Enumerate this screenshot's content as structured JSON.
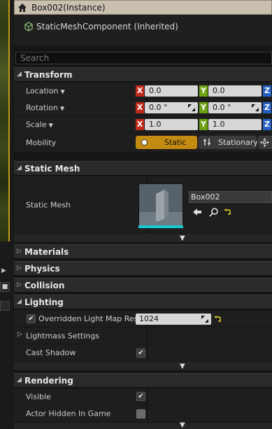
{
  "title_bar": {
    "title": "Box002(Instance)"
  },
  "component": {
    "label": "StaticMeshComponent (Inherited)"
  },
  "search": {
    "placeholder": "Search"
  },
  "transform": {
    "header": "Transform",
    "location": {
      "label": "Location",
      "x": "0.0",
      "y": "0.0",
      "z": "Z"
    },
    "rotation": {
      "label": "Rotation",
      "x": "0.0 °",
      "y": "0.0 °",
      "z": "Z"
    },
    "scale": {
      "label": "Scale",
      "x": "1.0",
      "y": "1.0",
      "z": "Z"
    },
    "axis_labels": {
      "x": "X",
      "y": "Y"
    },
    "mobility": {
      "label": "Mobility",
      "static": "Static",
      "stationary": "Stationary",
      "selected": "Static"
    }
  },
  "static_mesh": {
    "header": "Static Mesh",
    "label": "Static Mesh",
    "asset_name": "Box002"
  },
  "sections": {
    "materials": "Materials",
    "physics": "Physics",
    "collision": "Collision",
    "lighting": "Lighting",
    "rendering": "Rendering"
  },
  "lighting": {
    "override_label": "Overridden Light Map Res",
    "override_checked": true,
    "light_map_res": "1024",
    "lightmass_label": "Lightmass Settings",
    "cast_shadow_label": "Cast Shadow",
    "cast_shadow_checked": true
  },
  "rendering": {
    "visible_label": "Visible",
    "visible_checked": true,
    "hidden_label": "Actor Hidden In Game",
    "hidden_checked": false
  },
  "colors": {
    "accent_static": "#c48b12",
    "axis_x": "#c02a1b",
    "axis_y": "#6ea314",
    "axis_z": "#2760c4",
    "thumb_bar": "#16c7d4"
  },
  "glyphs": {
    "check": "✔",
    "arrow_right": "▷",
    "arrow_down": "◢",
    "expand": "▼",
    "caret": "▼",
    "strip_btn": "■",
    "strip_arrow": "▶"
  }
}
